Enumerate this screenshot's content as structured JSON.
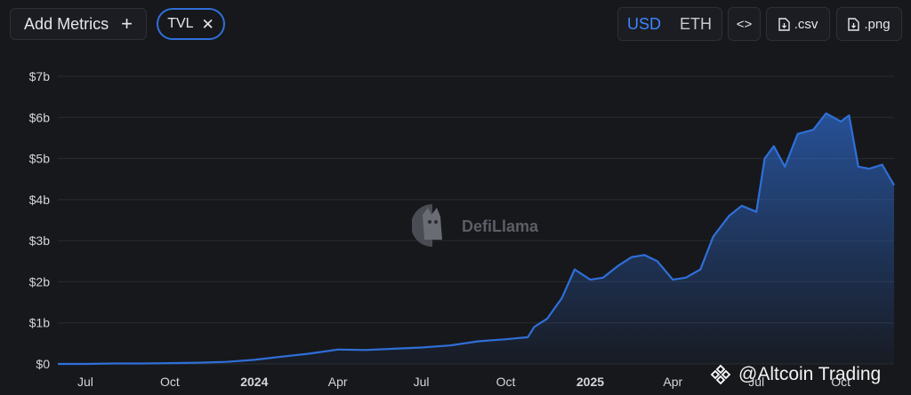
{
  "toolbar": {
    "add_metrics_label": "Add Metrics",
    "plus_icon": "+",
    "metric_chip_label": "TVL",
    "chip_close_icon": "✕",
    "currency_usd": "USD",
    "currency_eth": "ETH",
    "embed_label": "<>",
    "csv_label": ".csv",
    "png_label": ".png"
  },
  "watermark": {
    "text": "DefiLlama"
  },
  "overlay": {
    "text": "@Altcoin Trading"
  },
  "colors": {
    "accent": "#3a86ff",
    "line": "#2f6fd8",
    "background": "#17181c"
  },
  "chart_data": {
    "type": "area",
    "series": [
      {
        "values": [
          [
            "2023-06-01",
            0.0
          ],
          [
            "2023-07-01",
            0.0
          ],
          [
            "2023-08-01",
            0.01
          ],
          [
            "2023-09-01",
            0.01
          ],
          [
            "2023-10-01",
            0.02
          ],
          [
            "2023-11-01",
            0.03
          ],
          [
            "2023-12-01",
            0.05
          ],
          [
            "2024-01-01",
            0.1
          ],
          [
            "2024-02-01",
            0.18
          ],
          [
            "2024-03-01",
            0.25
          ],
          [
            "2024-04-01",
            0.35
          ],
          [
            "2024-05-01",
            0.34
          ],
          [
            "2024-06-01",
            0.37
          ],
          [
            "2024-07-01",
            0.4
          ],
          [
            "2024-08-01",
            0.45
          ],
          [
            "2024-09-01",
            0.55
          ],
          [
            "2024-10-01",
            0.6
          ],
          [
            "2024-10-25",
            0.65
          ],
          [
            "2024-11-01",
            0.9
          ],
          [
            "2024-11-15",
            1.1
          ],
          [
            "2024-12-01",
            1.6
          ],
          [
            "2024-12-15",
            2.3
          ],
          [
            "2025-01-01",
            2.05
          ],
          [
            "2025-01-15",
            2.1
          ],
          [
            "2025-02-01",
            2.4
          ],
          [
            "2025-02-15",
            2.6
          ],
          [
            "2025-03-01",
            2.65
          ],
          [
            "2025-03-15",
            2.5
          ],
          [
            "2025-04-01",
            2.05
          ],
          [
            "2025-04-15",
            2.1
          ],
          [
            "2025-05-01",
            2.3
          ],
          [
            "2025-05-15",
            3.1
          ],
          [
            "2025-06-01",
            3.6
          ],
          [
            "2025-06-15",
            3.85
          ],
          [
            "2025-07-01",
            3.7
          ],
          [
            "2025-07-10",
            5.0
          ],
          [
            "2025-07-20",
            5.3
          ],
          [
            "2025-08-01",
            4.8
          ],
          [
            "2025-08-15",
            5.6
          ],
          [
            "2025-09-01",
            5.7
          ],
          [
            "2025-09-15",
            6.1
          ],
          [
            "2025-10-01",
            5.9
          ],
          [
            "2025-10-10",
            6.05
          ],
          [
            "2025-10-20",
            4.8
          ],
          [
            "2025-11-01",
            4.75
          ],
          [
            "2025-11-15",
            4.85
          ],
          [
            "2025-11-28",
            4.35
          ]
        ]
      }
    ],
    "y_ticks": [
      "$0",
      "$1b",
      "$2b",
      "$3b",
      "$4b",
      "$5b",
      "$6b",
      "$7b"
    ],
    "x_ticks": [
      {
        "label": "Jul",
        "date": "2023-07-01",
        "bold": false
      },
      {
        "label": "Oct",
        "date": "2023-10-01",
        "bold": false
      },
      {
        "label": "2024",
        "date": "2024-01-01",
        "bold": true
      },
      {
        "label": "Apr",
        "date": "2024-04-01",
        "bold": false
      },
      {
        "label": "Jul",
        "date": "2024-07-01",
        "bold": false
      },
      {
        "label": "Oct",
        "date": "2024-10-01",
        "bold": false
      },
      {
        "label": "2025",
        "date": "2025-01-01",
        "bold": true
      },
      {
        "label": "Apr",
        "date": "2025-04-01",
        "bold": false
      },
      {
        "label": "Jul",
        "date": "2025-07-01",
        "bold": false
      },
      {
        "label": "Oct",
        "date": "2025-10-01",
        "bold": false
      }
    ],
    "ylim": [
      0,
      7
    ],
    "grid": true
  }
}
